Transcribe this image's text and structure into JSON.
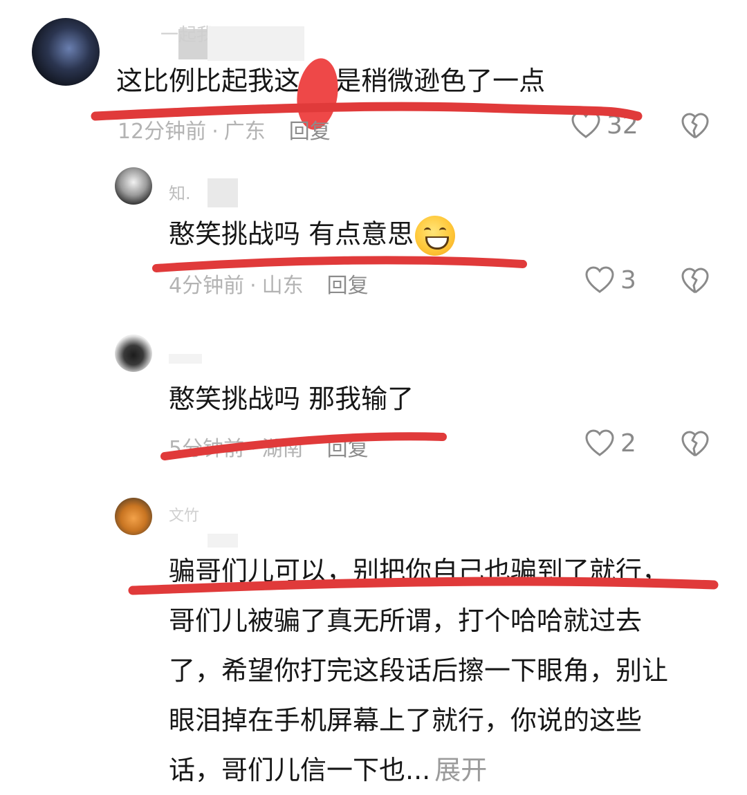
{
  "comments": [
    {
      "username_partial": "一起我",
      "text": "这比例比起我这 还是稍微逊色了一点",
      "time": "12分钟前",
      "location": "广东",
      "reply_label": "回复",
      "likes": "32"
    },
    {
      "username_partial": "知.",
      "text": "憨笑挑战吗  有点意思",
      "emoji": "grinning-face-emoji",
      "time": "4分钟前",
      "location": "山东",
      "reply_label": "回复",
      "likes": "3"
    },
    {
      "username_partial": "",
      "text": "憨笑挑战吗 那我输了",
      "time": "5分钟前",
      "location": "湖南",
      "reply_label": "回复",
      "likes": "2"
    },
    {
      "username_partial": "文竹",
      "lines": [
        "骗哥们儿可以，别把你自己也骗到了就行，",
        "哥们儿被骗了真无所谓，打个哈哈就过去",
        "了，希望你打完这段话后擦一下眼角，别让",
        "眼泪掉在手机屏幕上了就行，你说的这些",
        "话，哥们儿信一下也..."
      ],
      "expand_label": "展开"
    }
  ],
  "separator": "·",
  "colors": {
    "annotation_red": "#e03a3a",
    "meta_gray": "#b3b3b3",
    "icon_gray": "#8a8a8a"
  },
  "icons": [
    "heart-outline-icon",
    "broken-heart-icon"
  ]
}
